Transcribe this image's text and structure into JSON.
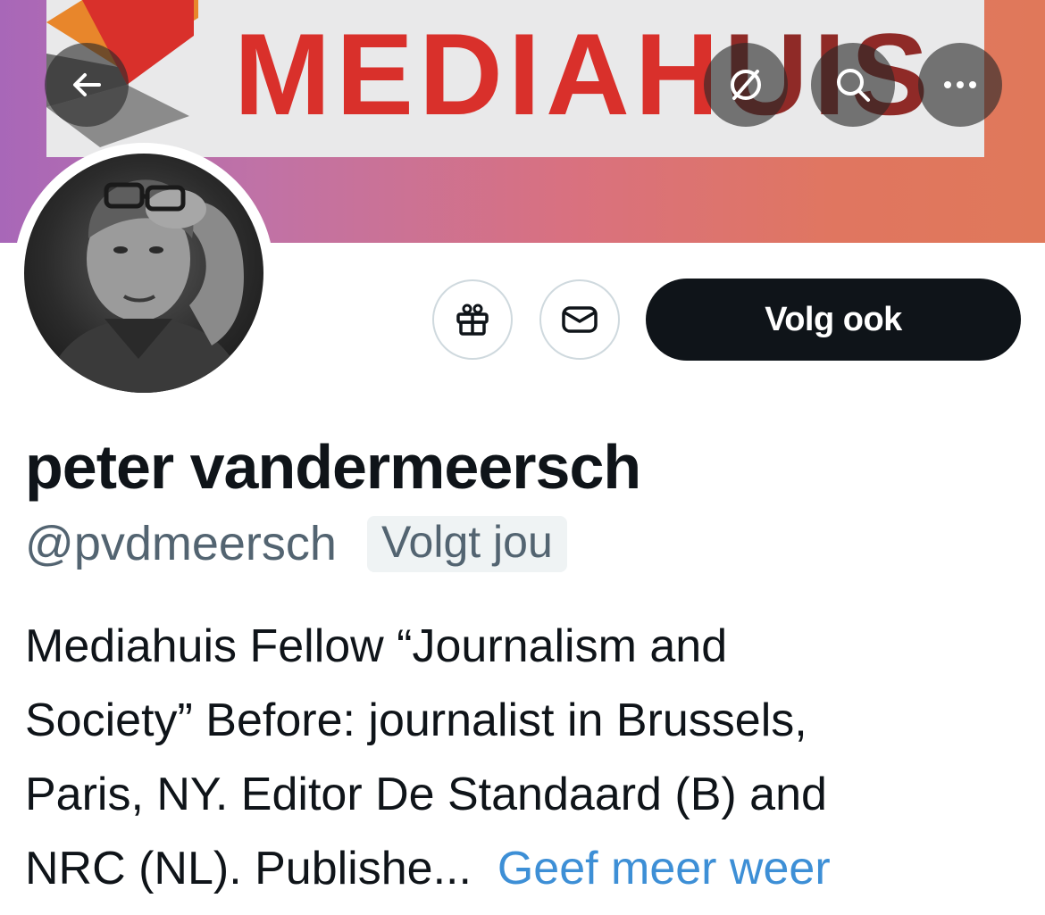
{
  "banner": {
    "logo_text_main": "MEDIAH",
    "logo_text_tail": "UIS",
    "colors": {
      "logo_red": "#d9302b",
      "logo_dark_red": "#8f2a27",
      "gradient_left": "#a867b8",
      "gradient_right": "#e0785a"
    }
  },
  "top_bar": {
    "back_icon": "arrow-left-icon",
    "translate_icon": "globe-slash-icon",
    "search_icon": "search-icon",
    "more_icon": "more-horizontal-icon"
  },
  "profile": {
    "avatar_icon": "avatar-photo",
    "display_name": "peter vandermeersch",
    "handle": "@pvdmeersch",
    "follows_you_badge": "Volgt jou",
    "bio_lines": [
      "Mediahuis Fellow “Journalism and",
      "Society” Before: journalist in Brussels,",
      "Paris, NY. Editor De Standaard (B) and",
      "NRC (NL). Publishe..."
    ],
    "show_more_link": "Geef meer weer"
  },
  "actions": {
    "gift_icon": "gift-icon",
    "message_icon": "envelope-icon",
    "follow_button_label": "Volg ook",
    "colors": {
      "follow_bg": "#0f1419",
      "link": "#3d8fd6",
      "secondary_text": "#536471"
    }
  }
}
